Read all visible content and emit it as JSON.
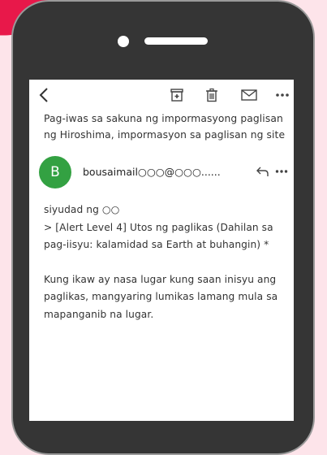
{
  "toolbar": {
    "back_icon": "chevron-left-icon",
    "archive_icon": "archive-icon",
    "delete_icon": "trash-icon",
    "mail_icon": "envelope-icon",
    "more_icon": "more-horizontal-icon"
  },
  "email": {
    "subject_line1": "Pag-iwas sa sakuna ng impormasyong paglisan",
    "subject_line2": "ng Hiroshima, impormasyon sa paglisan ng site",
    "sender_initial": "B",
    "sender": "bousaimail○○○@○○○......",
    "body_line1": "siyudad ng ○○",
    "body_line2": "> [Alert Level 4] Utos ng paglikas (Dahilan sa",
    "body_line3": "pag-iisyu: kalamidad sa Earth at buhangin) *",
    "body_line4": "Kung ikaw ay nasa lugar kung saan inisyu ang",
    "body_line5": "paglikas, mangyaring lumikas lamang mula sa",
    "body_line6": "mapanganib na lugar."
  },
  "colors": {
    "background": "#fde4ea",
    "accent": "#e8184a",
    "avatar": "#33a142",
    "phone_body": "#353535"
  }
}
